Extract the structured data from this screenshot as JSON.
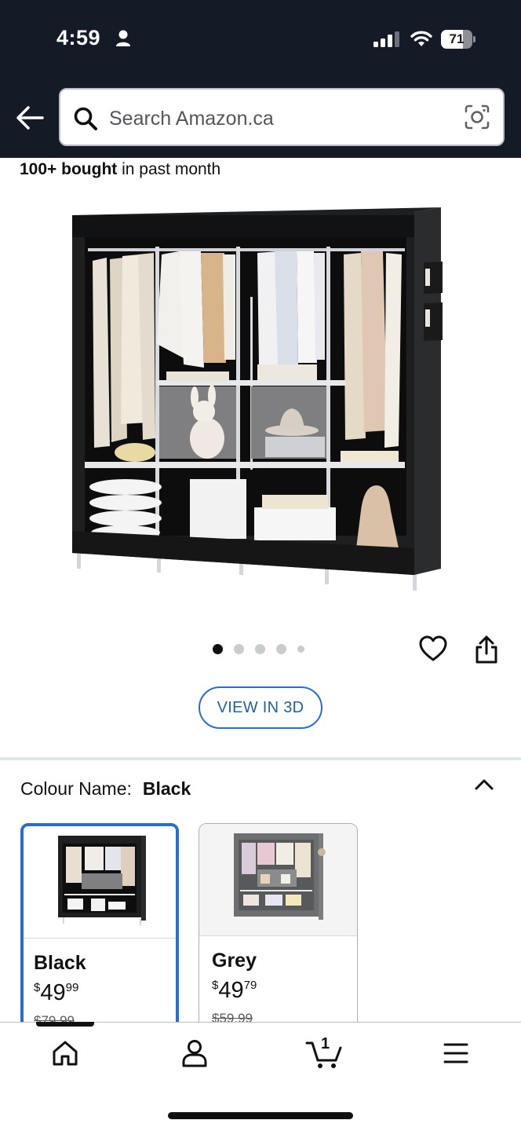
{
  "status_bar": {
    "time": "4:59",
    "battery": "71",
    "battery_level": 0.71
  },
  "search": {
    "placeholder": "Search Amazon.ca"
  },
  "product": {
    "bought_count": "100+ bought",
    "bought_suffix": " in past month",
    "image_count": 5,
    "active_image_index": 0,
    "view_3d_label": "VIEW IN 3D"
  },
  "colour": {
    "label": "Colour Name:",
    "selected_value": "Black",
    "options": [
      {
        "name": "Black",
        "currency": "$",
        "price_whole": "49",
        "price_cents": "99",
        "list_price": "$79.99",
        "selected": true
      },
      {
        "name": "Grey",
        "currency": "$",
        "price_whole": "49",
        "price_cents": "79",
        "list_price": "$59.99",
        "selected": false
      }
    ]
  },
  "bottom_nav": {
    "cart_count": "1",
    "items": [
      "home-icon",
      "account-icon",
      "cart-icon",
      "menu-icon"
    ]
  },
  "colors": {
    "header_bg": "#141b26",
    "accent_blue": "#2a6dd2",
    "text": "#0f1111"
  }
}
